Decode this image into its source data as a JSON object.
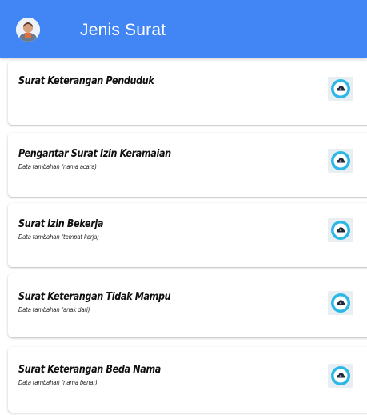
{
  "appbar": {
    "title": "Jenis Surat"
  },
  "letters": [
    {
      "title": "Surat Keterangan Penduduk",
      "subtitle": ""
    },
    {
      "title": "Pengantar Surat Izin Keramaian",
      "subtitle": "Data tambahan (nama acara)"
    },
    {
      "title": "Surat Izin Bekerja",
      "subtitle": "Data tambahan (tempat kerja)"
    },
    {
      "title": "Surat Keterangan Tidak Mampu",
      "subtitle": "Data tambahan (anak dari)"
    },
    {
      "title": "Surat Keterangan Beda Nama",
      "subtitle": "Data tambahan (nama benar)"
    }
  ],
  "icons": {
    "avatar": "avatar",
    "action": "cloud-download-icon"
  },
  "colors": {
    "appbar": "#4285f4",
    "icon_circle": "#2bb8e6",
    "icon_glyph": "#1f2a36"
  }
}
